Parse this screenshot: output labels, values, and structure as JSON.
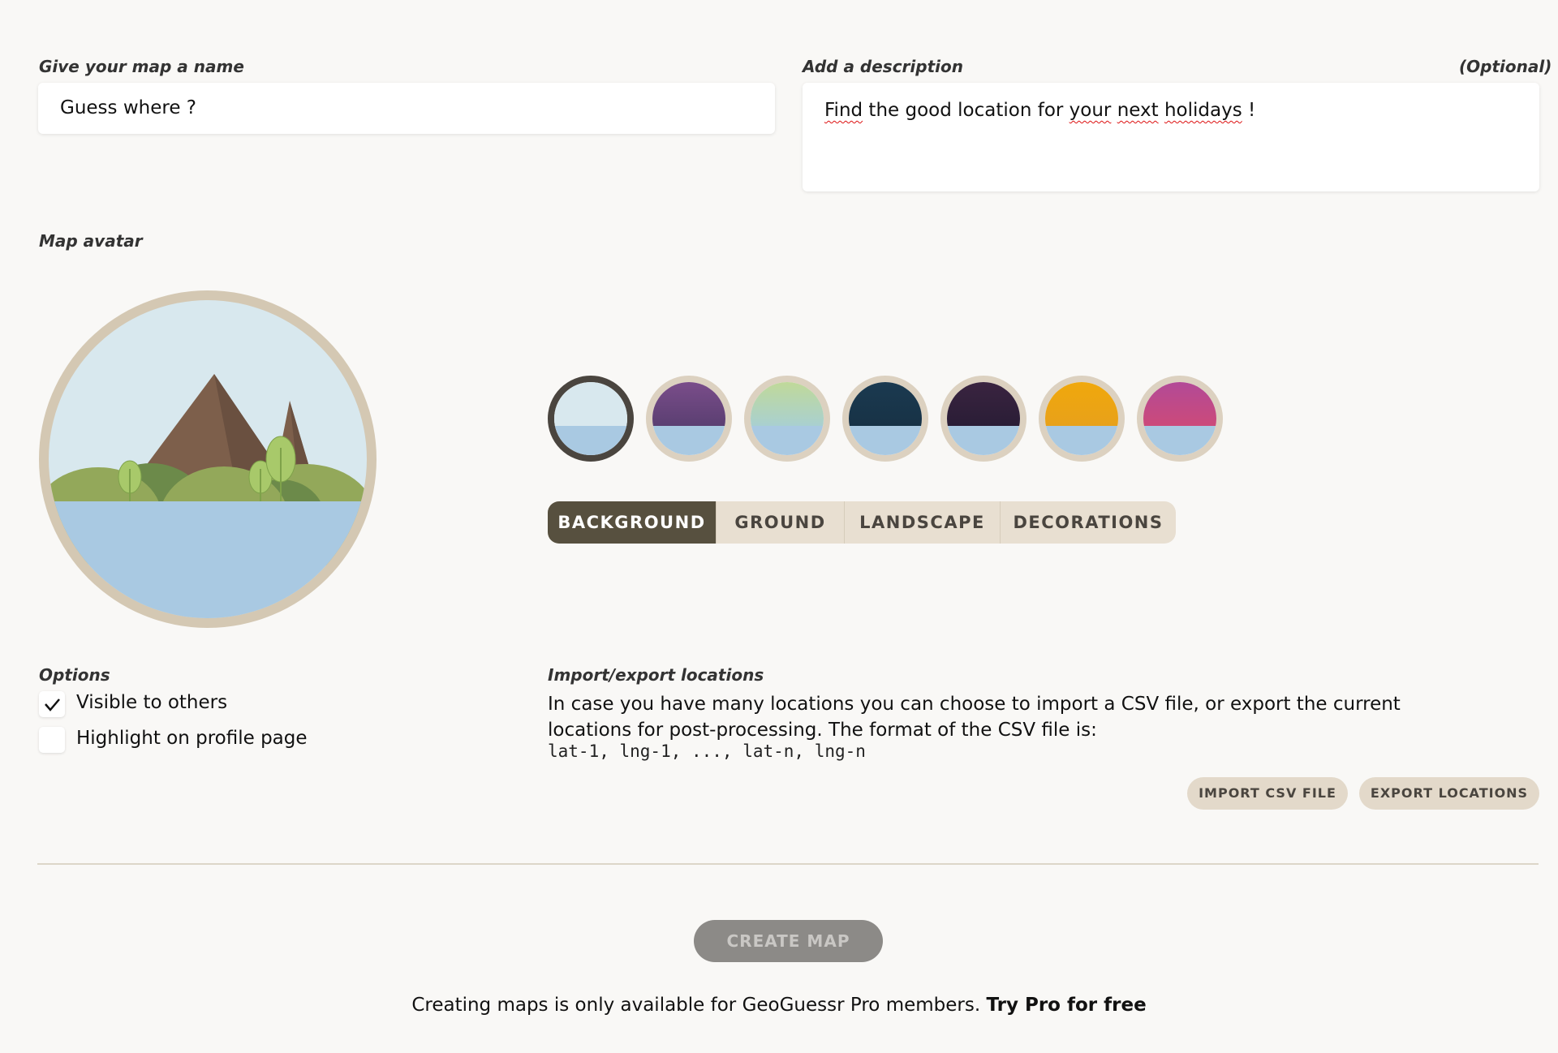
{
  "name_section": {
    "label": "Give your map a name",
    "value": "Guess where ?"
  },
  "description_section": {
    "label": "Add a description",
    "optional": "(Optional)",
    "value_part1": "Find",
    "value_part2": " the good location for ",
    "value_part3": "your",
    "value_part4": " ",
    "value_part5": "next",
    "value_part6": " ",
    "value_part7": "holidays",
    "value_part8": " !"
  },
  "avatar": {
    "label": "Map avatar",
    "swatch_colors": [
      {
        "top": "#d8e8ee",
        "top2": "#d8e8ee"
      },
      {
        "top": "#7a4d8a",
        "top2": "#5b3f72"
      },
      {
        "top": "#c0d999",
        "top2": "#a9d0d0"
      },
      {
        "top": "#1b3a50",
        "top2": "#173246"
      },
      {
        "top": "#3a2440",
        "top2": "#2a1d36"
      },
      {
        "top": "#f0a80c",
        "top2": "#e8a11a"
      },
      {
        "top": "#b24a97",
        "top2": "#cc4a7a"
      }
    ],
    "tabs": [
      {
        "label": "BACKGROUND",
        "active": true
      },
      {
        "label": "GROUND",
        "active": false
      },
      {
        "label": "LANDSCAPE",
        "active": false
      },
      {
        "label": "DECORATIONS",
        "active": false
      }
    ]
  },
  "options": {
    "label": "Options",
    "items": [
      {
        "label": "Visible to others",
        "checked": true
      },
      {
        "label": "Highlight on profile page",
        "checked": false
      }
    ]
  },
  "import_export": {
    "label": "Import/export locations",
    "description": "In case you have many locations you can choose to import a CSV file, or export the current locations for post-processing. The format of the CSV file is:",
    "format": "lat-1, lng-1, ..., lat-n, lng-n",
    "import_button": "IMPORT CSV FILE",
    "export_button": "EXPORT LOCATIONS"
  },
  "create_button": "CREATE MAP",
  "footer": {
    "text": "Creating maps is only available for GeoGuessr Pro members. ",
    "link": "Try Pro for free"
  },
  "colors": {
    "page_bg": "#f9f8f6",
    "accent_dark": "#57503f",
    "tab_bg": "#e8dfd1",
    "water": "#a9c9e2",
    "ring": "#d4c8b3"
  }
}
